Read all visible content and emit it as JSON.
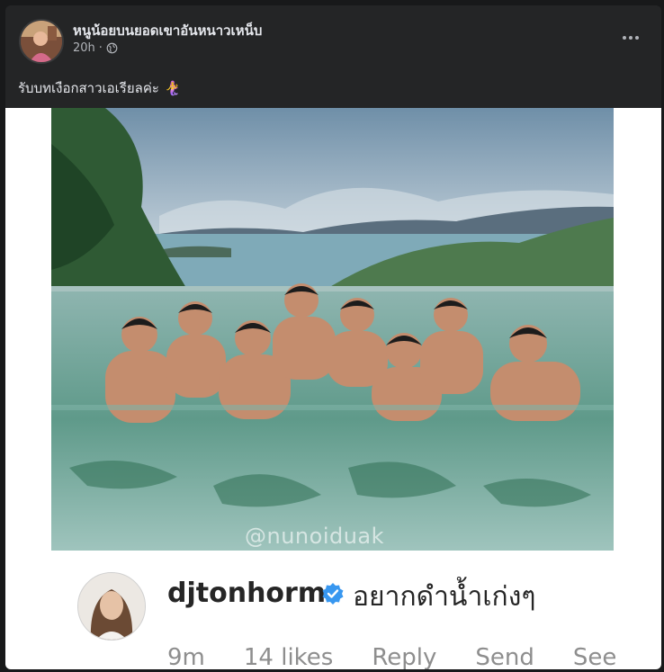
{
  "post": {
    "author": "หนูน้อยบนยอดเขาอันหนาวเหน็บ",
    "time": "20h",
    "privacy_icon": "globe-icon",
    "more_icon": "more-options-icon",
    "caption": "รับบทเงือกสาวเอเรียลค่ะ",
    "caption_emoji": "🧜‍♀️"
  },
  "image": {
    "watermark": "@nunoiduak",
    "comment": {
      "username": "djtonhorm",
      "verified": true,
      "text": "อยากดำน้ำเก่งๆ",
      "time": "9m",
      "likes": "14 likes",
      "reply": "Reply",
      "see": "See"
    }
  },
  "colors": {
    "background": "#18191a",
    "card": "#242526",
    "text_primary": "#e4e6eb",
    "text_secondary": "#b0b3b8",
    "verified_blue": "#3897f0"
  }
}
